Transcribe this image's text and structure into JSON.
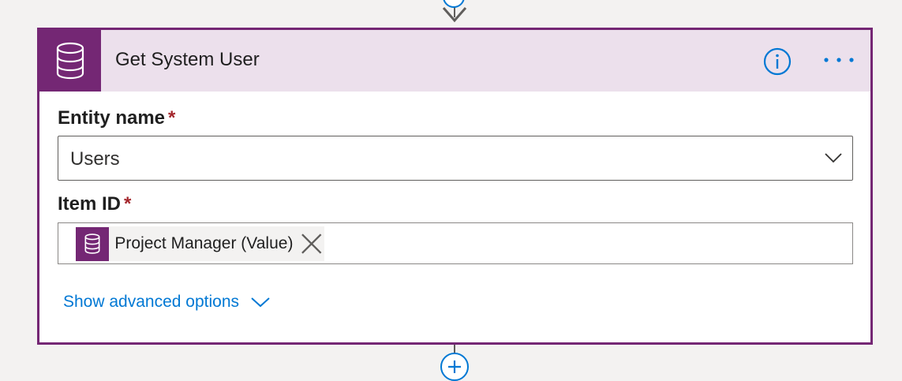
{
  "card": {
    "title": "Get System User",
    "accent_color": "#742774",
    "header_bg_color": "#ece0ec",
    "header_icon": "database-icon",
    "info_icon": "info-icon",
    "more_icon": "more-options-icon"
  },
  "fields": {
    "entity_name": {
      "label": "Entity name",
      "required_mark": "*",
      "value": "Users",
      "dropdown_icon": "chevron-down-icon"
    },
    "item_id": {
      "label": "Item ID",
      "required_mark": "*",
      "token": {
        "label": "Project Manager (Value)",
        "icon": "database-icon",
        "remove_icon": "close-icon"
      }
    }
  },
  "advanced": {
    "label": "Show advanced options",
    "icon": "chevron-down-icon"
  },
  "connector": {
    "add_step_icon": "plus-icon"
  }
}
